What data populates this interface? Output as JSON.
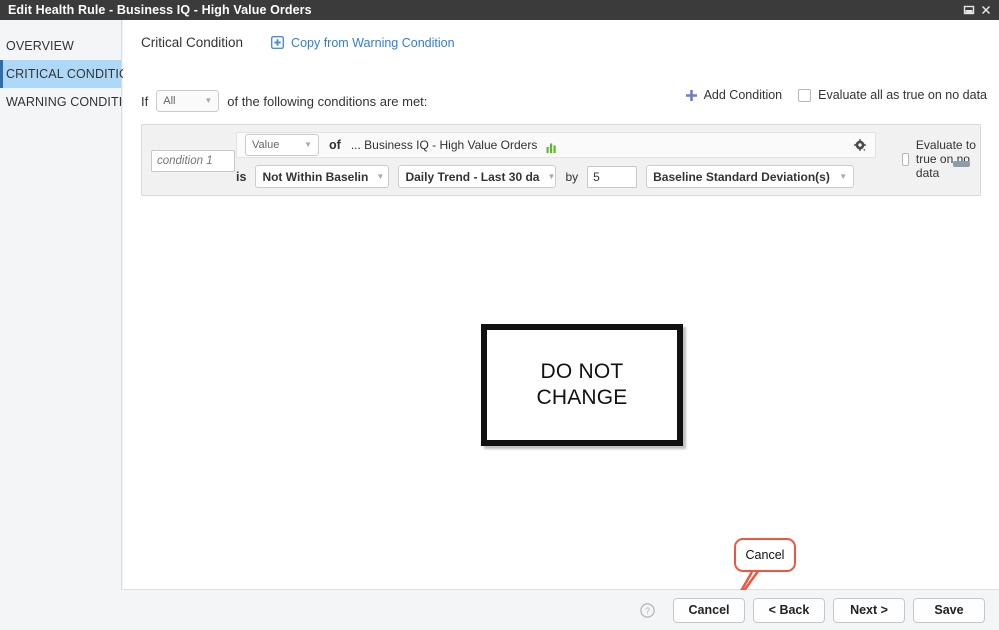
{
  "window": {
    "title": "Edit Health Rule - Business IQ - High Value Orders",
    "maximize_icon": "maximize-icon",
    "close_icon": "close-icon"
  },
  "sidebar": {
    "items": [
      {
        "label": "OVERVIEW",
        "active": false
      },
      {
        "label": "CRITICAL CONDITION",
        "active": true
      },
      {
        "label": "WARNING CONDITION",
        "active": false
      }
    ]
  },
  "header": {
    "title": "Critical Condition",
    "copy_link_label": "Copy from Warning Condition",
    "copy_icon": "copy-plus-icon"
  },
  "if_row": {
    "prefix": "If",
    "match_value": "All",
    "suffix": "of the following conditions are met:"
  },
  "right_controls": {
    "add_condition_label": "Add Condition",
    "add_icon": "plus-icon",
    "evaluate_all_label": "Evaluate all as true on no data",
    "evaluate_all_checked": false
  },
  "condition": {
    "name_placeholder": "condition 1",
    "value_selector": "Value",
    "of_label": "of",
    "metric_path": "... Business IQ - High Value Orders",
    "metric_chart_icon": "bar-chart-icon",
    "gear_icon": "gear-dropdown-icon",
    "evaluate_true_label": "Evaluate to true on no data",
    "evaluate_true_checked": false,
    "remove_icon": "minus-icon",
    "is_label": "is",
    "operator": "Not Within Baselin",
    "baseline_trend": "Daily Trend - Last 30 da",
    "by_label": "by",
    "by_value": "5",
    "unit": "Baseline Standard Deviation(s)"
  },
  "annotations": {
    "do_not_change": "DO NOT\nCHANGE",
    "callout_label": "Cancel",
    "callout_color": "#ef5541"
  },
  "footer": {
    "help_icon": "help-icon",
    "buttons": [
      {
        "label": "Cancel"
      },
      {
        "label": "< Back"
      },
      {
        "label": "Next >"
      },
      {
        "label": "Save"
      }
    ]
  }
}
